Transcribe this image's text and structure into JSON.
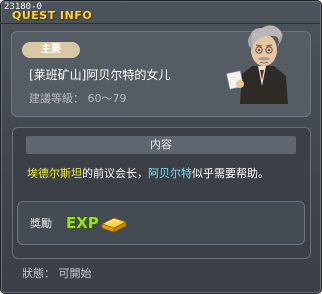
{
  "window": {
    "quest_id": "23180-0",
    "title": "QUEST INFO"
  },
  "info": {
    "category_badge": "主要",
    "quest_name": "[莱班矿山]阿贝尔特的女儿",
    "level_requirement": "建議等級： 60～79"
  },
  "content": {
    "header": "内容",
    "description": {
      "part1": "埃德尔斯坦",
      "part2": "的前议会长，",
      "part3": "阿贝尔特",
      "part4": "似乎需要帮助。"
    },
    "colors": {
      "highlight_place": "#f2f244",
      "highlight_npc": "#6fe3ff"
    }
  },
  "reward": {
    "label": "獎勵",
    "items": [
      "EXP",
      "gold-bar-icon"
    ]
  },
  "status": {
    "text": "狀態： 可開始"
  },
  "icons": [
    "npc-portrait",
    "exp-icon",
    "gold-bar-icon"
  ]
}
